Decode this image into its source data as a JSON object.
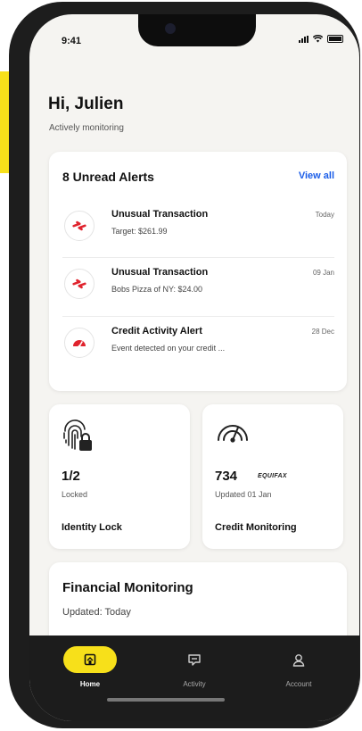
{
  "status_bar": {
    "time": "9:41"
  },
  "header": {
    "greeting": "Hi, Julien",
    "subtitle": "Actively monitoring"
  },
  "alerts": {
    "title": "8 Unread Alerts",
    "view_all": "View all",
    "items": [
      {
        "title": "Unusual Transaction",
        "description": "Target: $261.99",
        "date": "Today",
        "icon": "transaction-icon"
      },
      {
        "title": "Unusual Transaction",
        "description": "Bobs Pizza of NY: $24.00",
        "date": "09 Jan",
        "icon": "transaction-icon"
      },
      {
        "title": "Credit Activity Alert",
        "description": "Event detected on your credit ...",
        "date": "28 Dec",
        "icon": "credit-gauge-icon"
      }
    ]
  },
  "identity_card": {
    "value": "1/2",
    "status": "Locked",
    "label": "Identity Lock",
    "icon": "fingerprint-lock-icon"
  },
  "credit_card": {
    "score": "734",
    "bureau": "EQUIFAX",
    "updated": "Updated 01 Jan",
    "label": "Credit Monitoring",
    "icon": "credit-gauge-icon"
  },
  "financial_card": {
    "title": "Financial Monitoring",
    "updated": "Updated: Today"
  },
  "tabbar": {
    "tabs": [
      {
        "label": "Home",
        "icon": "home-icon",
        "active": true
      },
      {
        "label": "Activity",
        "icon": "chat-icon",
        "active": false
      },
      {
        "label": "Account",
        "icon": "user-icon",
        "active": false
      }
    ]
  },
  "colors": {
    "accent_yellow": "#f7e01a",
    "link_blue": "#1a5de8",
    "alert_red": "#e0232d",
    "tabbar_dark": "#1c1c1c",
    "screen_bg": "#f5f4f1"
  }
}
